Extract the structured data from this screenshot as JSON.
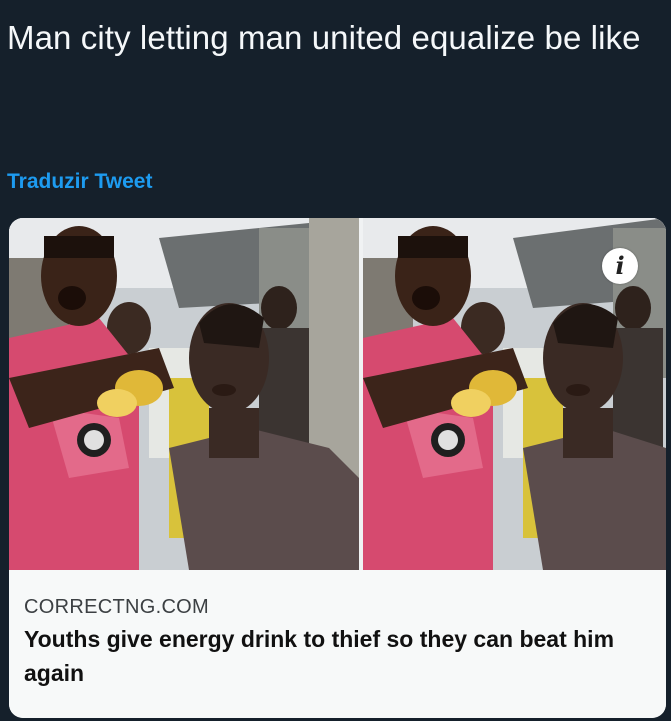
{
  "tweet": {
    "text": "Man city letting man united equalize be like",
    "translate_label": "Traduzir Tweet"
  },
  "card": {
    "info_icon": "i",
    "domain": "CORRECTNG.COM",
    "title": "Youths give energy drink to thief so they can beat him again"
  },
  "colors": {
    "background": "#15202b",
    "link": "#1d9bf0",
    "card_background": "#f7f9f9"
  }
}
